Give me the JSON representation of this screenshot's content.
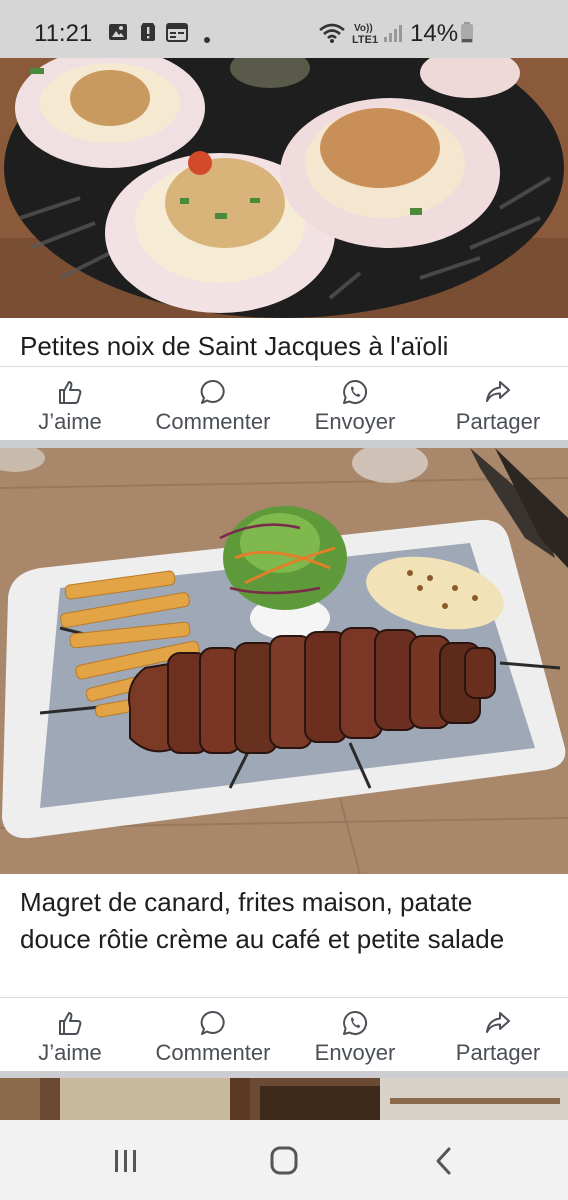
{
  "status_bar": {
    "time": "11:21",
    "battery": "14%",
    "network": "LTE1",
    "icons": [
      "image-icon",
      "alert-icon",
      "calendar-icon",
      "dot-icon",
      "wifi-icon",
      "volte-icon",
      "signal-icon",
      "battery-icon"
    ]
  },
  "posts": [
    {
      "image": "scallops-photo",
      "caption": "Petites noix de Saint Jacques à l'aïoli",
      "actions": {
        "like": "J’aime",
        "comment": "Commenter",
        "send": "Envoyer",
        "share": "Partager"
      }
    },
    {
      "image": "duck-steak-photo",
      "caption": "Magret de canard, frites maison, patate douce rôtie crème au café et petite salade",
      "actions": {
        "like": "J’aime",
        "comment": "Commenter",
        "send": "Envoyer",
        "share": "Partager"
      }
    }
  ],
  "nav_bar": {
    "icons": [
      "recent-apps-icon",
      "home-icon",
      "back-icon"
    ]
  },
  "colors": {
    "status_bar": "#d6d6d6",
    "separator": "#cbcdd1",
    "action_text": "#4b4f56",
    "nav_bar": "#f2f2f2"
  }
}
